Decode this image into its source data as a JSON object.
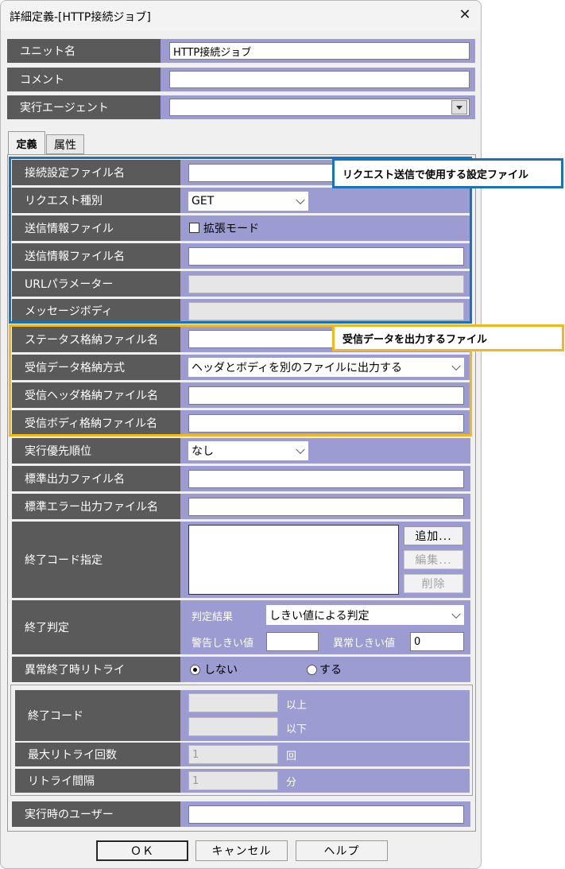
{
  "window": {
    "title": "詳細定義-[HTTP接続ジョブ]",
    "close_glyph": "✕"
  },
  "top": {
    "unit_name_label": "ユニット名",
    "unit_name_value": "HTTP接続ジョブ",
    "comment_label": "コメント",
    "comment_value": "",
    "agent_label": "実行エージェント",
    "agent_value": ""
  },
  "tabs": [
    {
      "label": "定義",
      "active": true
    },
    {
      "label": "属性",
      "active": false
    }
  ],
  "rows": {
    "conn_file_label": "接続設定ファイル名",
    "request_type_label": "リクエスト種別",
    "request_type_value": "GET",
    "send_info_label": "送信情報ファイル",
    "extended_mode_label": "拡張モード",
    "send_info_name_label": "送信情報ファイル名",
    "url_param_label": "URLパラメーター",
    "message_body_label": "メッセージボディ",
    "status_file_label": "ステータス格納ファイル名",
    "receive_method_label": "受信データ格納方式",
    "receive_method_value": "ヘッダとボディを別のファイルに出力する",
    "receive_header_label": "受信ヘッダ格納ファイル名",
    "receive_body_label": "受信ボディ格納ファイル名",
    "priority_label": "実行優先順位",
    "priority_value": "なし",
    "stdout_label": "標準出力ファイル名",
    "stderr_label": "標準エラー出力ファイル名",
    "exit_code_label": "終了コード指定",
    "add_button": "追加...",
    "edit_button": "編集...",
    "delete_button": "削除",
    "end_judge_label": "終了判定",
    "judge_result_label": "判定結果",
    "judge_result_value": "しきい値による判定",
    "warn_threshold_label": "警告しきい値",
    "warn_threshold_value": "",
    "error_threshold_label": "異常しきい値",
    "error_threshold_value": "0",
    "retry_label": "異常終了時リトライ",
    "retry_no": "しない",
    "retry_yes": "する",
    "retry_selected": "no",
    "retry_exit_code_label": "終了コード",
    "above_label": "以上",
    "below_label": "以下",
    "max_retry_label": "最大リトライ回数",
    "max_retry_value": "1",
    "times_unit": "回",
    "retry_interval_label": "リトライ間隔",
    "retry_interval_value": "1",
    "minutes_unit": "分",
    "run_user_label": "実行時のユーザー"
  },
  "buttons": {
    "ok": "ＯＫ",
    "cancel": "キャンセル",
    "help": "ヘルプ"
  },
  "callouts": {
    "blue": "リクエスト送信で使用する設定ファイル",
    "yellow": "受信データを出力するファイル"
  },
  "colors": {
    "label_bg": "#5a5a5a",
    "field_bg": "#9c9bd2",
    "blue": "#1a72b8",
    "yellow": "#f2b81c"
  }
}
